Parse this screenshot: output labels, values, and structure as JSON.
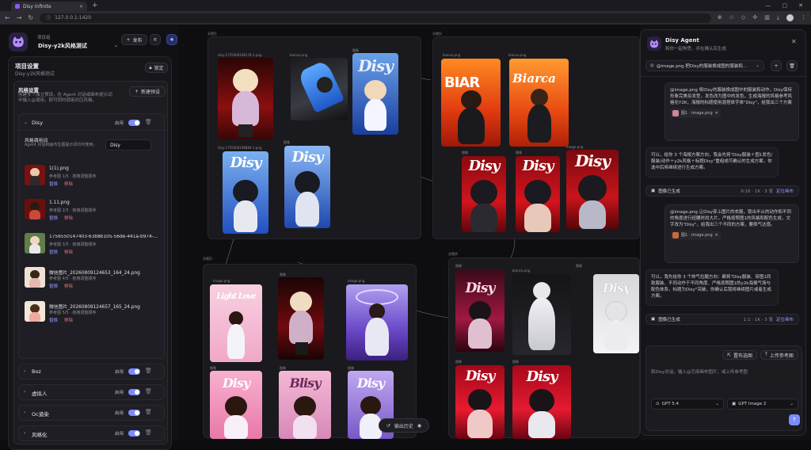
{
  "browser": {
    "tab_title": "Disy Infinite",
    "url": "127.0.0.1:1420"
  },
  "header": {
    "project_label": "项目组",
    "project_name": "Disy-y2k风格测试",
    "publish_label": "发布"
  },
  "left_panel": {
    "title": "项目设置",
    "subtitle": "Disy-y2k风格测试",
    "lock_label": "锁定",
    "style_section": {
      "title": "风格设置",
      "desc": "创建多个独立预设，在 Agent 对话或画布提示词中输入@调用，即可同时调用对应风格。",
      "new_preset_label": "新建预设"
    },
    "expanded_preset": {
      "name": "Disy",
      "enabled_label": "启用",
      "keyword_title": "风格调用词",
      "keyword_desc": "Agent 对话和画布生图提示词均可使用。",
      "keyword_value": "Disy",
      "refs": [
        {
          "file": "1(1).png",
          "meta": "参考图 1/5 · 拖拽调整顺序",
          "replace": "替换",
          "remove": "移除"
        },
        {
          "file": "1.11.png",
          "meta": "参考图 2/5 · 拖拽调整顺序",
          "replace": "替换",
          "remove": "移除"
        },
        {
          "file": "1756550147403-63b8b105-56de-441a-b974-...",
          "meta": "参考图 3/5 · 拖拽调整顺序",
          "replace": "替换",
          "remove": "移除"
        },
        {
          "file": "微信图片_20260809124653_164_24.png",
          "meta": "参考图 4/5 · 拖拽调整顺序",
          "replace": "替换",
          "remove": "移除"
        },
        {
          "file": "微信图片_20260809124657_165_24.png",
          "meta": "参考图 5/5 · 拖拽调整顺序",
          "replace": "替换",
          "remove": "移除"
        }
      ]
    },
    "collapsed_presets": [
      {
        "name": "Boz",
        "enabled_label": "启用"
      },
      {
        "name": "虚拟人",
        "enabled_label": "启用"
      },
      {
        "name": "Oc道染",
        "enabled_label": "启用"
      },
      {
        "name": "风格化",
        "enabled_label": "启用"
      }
    ]
  },
  "canvas": {
    "groups": [
      {
        "title": "分组1"
      },
      {
        "title": "分组2"
      },
      {
        "title": "分组3"
      },
      {
        "title": "分组4"
      }
    ],
    "labels": {
      "g1_a": "disy-1755060198178-1.png",
      "g1_b": "bianca.png",
      "g1_c": "图像",
      "g1_d": "disy-1755060198884-1.png",
      "g1_e": "图像",
      "g2_a": "bianca.png",
      "g2_b": "bianca.png",
      "g2_c": "图像",
      "g2_d": "图像",
      "g2_e": "image.png",
      "g3_a": "image.png",
      "g3_b": "图像",
      "g3_c": "image.png",
      "g3_d": "图像",
      "g3_e": "图像",
      "g3_f": "图像",
      "g4_a": "图像",
      "g4_b": "bianca.png",
      "g4_c": "图像",
      "g4_d": "图像",
      "g4_e": "图像"
    },
    "poster_words": {
      "disy": "Disy",
      "light_love": "Light Love",
      "blisy": "Blisy"
    },
    "bottom_pill": "输出历史"
  },
  "right_panel": {
    "title": "Disy Agent",
    "subtitle": "和你一起构思，并在确认后生成",
    "session_select": "@image.png 把Disy的服装换成图的服装和...",
    "msgs": {
      "user1": "@image.png 将Disy的服装换成图中的服装和动作，Disy保持形象完美及发型，发色改为图中的发色，生成海报的风格参考风格化Y2K，海报的标题使用混搭体字体\"Disy\"，给我出三个方案",
      "user1_chip": "图1 · image.png",
      "agent1": "可以，给你 3 个海报方案方向，我会先将\"Disy服装＋图1发色/服装/动作＋y2k风格＋标题Disy\"重组成可确认的生成方案，你选中后将继续进行生成方案。",
      "status1_label": "图像已生成",
      "status1_meta": "9:16 · 1K · 3 张",
      "status1_link": "定位画布",
      "user2": "@image.png 让Disy穿上图片的衣服，锁出半从的动作和不同的角度进行扭腰时尚大片，严格按照图1的风格和配色生成，文字改为\"Disy\"，给我出三个不同的方案，要摔气达感。",
      "user2_chip": "图1 · image.png",
      "agent2": "可以，我先给你 3 个帅气拉腿方向：都将\"Disy服装、穿图1同款服装、不同动作于不同角度、严格按照图1的y2k海报气场与配色体系，标题为Disy\"突破，你确认后我将继续图片或者生成方案。",
      "status2_label": "图像已生成",
      "status2_meta": "1:1 · 1K · 3 张",
      "status2_link": "定位画布"
    },
    "composer": {
      "style_btn": "置布选图",
      "upload_btn": "上传参考图",
      "placeholder": "和Disy对话，输入@引用画布图片，或上传参考图",
      "model_text": "GPT 5.4",
      "model_image": "GPT Image 2"
    }
  },
  "colors": {
    "accent": "#7b8cff",
    "panel": "#17171b",
    "bg": "#0e0e11"
  }
}
